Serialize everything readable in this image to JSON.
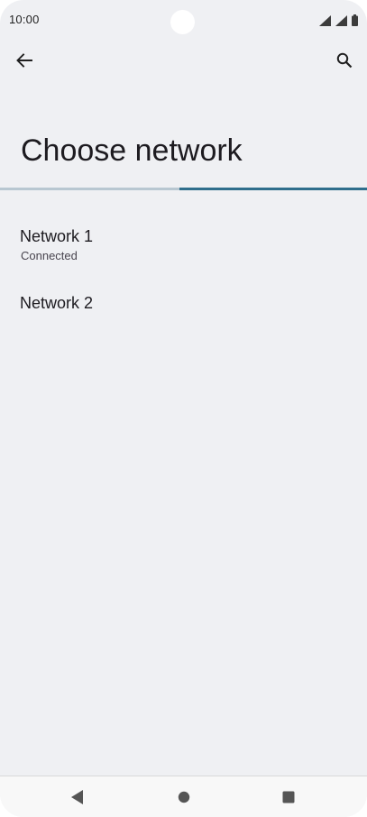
{
  "status_bar": {
    "time": "10:00",
    "icons": [
      "signal-icon",
      "signal-icon",
      "battery-icon"
    ]
  },
  "top_bar": {
    "back_icon": "arrow-back-icon",
    "search_icon": "search-icon"
  },
  "page": {
    "title": "Choose network",
    "progress_fraction": 0.51
  },
  "networks": [
    {
      "name": "Network 1",
      "status": "Connected"
    },
    {
      "name": "Network 2",
      "status": ""
    }
  ],
  "nav_bar": {
    "icons": [
      "nav-back-icon",
      "nav-home-icon",
      "nav-recents-icon"
    ]
  },
  "colors": {
    "background": "#eff0f3",
    "progress_track": "#b8c7d1",
    "progress_indicator": "#2f6e8c",
    "text_primary": "#1d1b20",
    "text_secondary": "#49454f"
  }
}
